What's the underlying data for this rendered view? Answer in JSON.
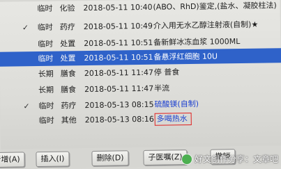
{
  "rows": [
    {
      "check": "",
      "type": "临时",
      "category": "化验",
      "time": "2018-05-11 10:40",
      "content": "(ABO、RhD)鉴定,(盐水、凝胶柱法)"
    },
    {
      "check": "✓",
      "type": "临时",
      "category": "药疗",
      "time": "2018-05-11 10:49",
      "content": "介入用无水乙醇注射液(自制)★"
    },
    {
      "check": "",
      "type": "临时",
      "category": "处置",
      "time": "2018-05-11 10:51",
      "content": "备新鲜冰冻血浆 1000ML"
    },
    {
      "check": "",
      "type": "临时",
      "category": "处置",
      "time": "2018-05-11 10:51",
      "content": "备悬浮红细胞 10U"
    },
    {
      "check": "",
      "type": "长期",
      "category": "膳食",
      "time": "2018-05-11 11:47",
      "content": "停 普食"
    },
    {
      "check": "",
      "type": "长期",
      "category": "膳食",
      "time": "2018-05-11 11:47",
      "content": "半流"
    },
    {
      "check": "✓",
      "type": "临时",
      "category": "药疗",
      "time": "2018-05-13 08:15",
      "content": "硫酸镁(自制)"
    },
    {
      "check": "",
      "type": "临时",
      "category": "其他",
      "time": "2018-05-13 08:16",
      "content": "多喝热水"
    }
  ],
  "buttons": [
    "新增(A)",
    "插入(I)",
    "删除(D)",
    "子医嘱(Z)",
    "撤销"
  ],
  "watermark": "好文创作分享：文章吧",
  "colors": {
    "selected_row": "#2f62c9",
    "highlight_border": "#e02020",
    "blue_text": "#1b3fd0"
  }
}
